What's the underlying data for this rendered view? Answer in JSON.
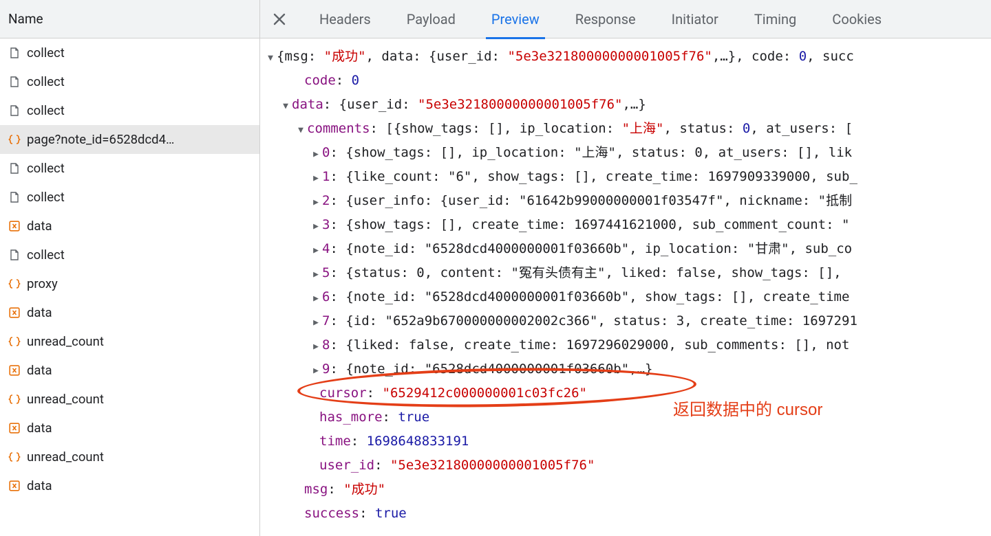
{
  "left": {
    "header": "Name",
    "items": [
      {
        "icon": "doc",
        "name": "collect",
        "selected": false
      },
      {
        "icon": "doc",
        "name": "collect",
        "selected": false
      },
      {
        "icon": "doc",
        "name": "collect",
        "selected": false
      },
      {
        "icon": "json-orange",
        "name": "page?note_id=6528dcd4…",
        "selected": true
      },
      {
        "icon": "doc",
        "name": "collect",
        "selected": false
      },
      {
        "icon": "doc",
        "name": "collect",
        "selected": false
      },
      {
        "icon": "xhr-orange",
        "name": "data",
        "selected": false
      },
      {
        "icon": "doc",
        "name": "collect",
        "selected": false
      },
      {
        "icon": "json-orange",
        "name": "proxy",
        "selected": false
      },
      {
        "icon": "xhr-orange",
        "name": "data",
        "selected": false
      },
      {
        "icon": "json-orange",
        "name": "unread_count",
        "selected": false
      },
      {
        "icon": "xhr-orange",
        "name": "data",
        "selected": false
      },
      {
        "icon": "json-orange",
        "name": "unread_count",
        "selected": false
      },
      {
        "icon": "xhr-orange",
        "name": "data",
        "selected": false
      },
      {
        "icon": "json-orange",
        "name": "unread_count",
        "selected": false
      },
      {
        "icon": "xhr-orange",
        "name": "data",
        "selected": false
      }
    ]
  },
  "tabs": [
    {
      "label": "Headers",
      "active": false
    },
    {
      "label": "Payload",
      "active": false
    },
    {
      "label": "Preview",
      "active": true
    },
    {
      "label": "Response",
      "active": false
    },
    {
      "label": "Initiator",
      "active": false
    },
    {
      "label": "Timing",
      "active": false
    },
    {
      "label": "Cookies",
      "active": false
    }
  ],
  "preview": {
    "root_summary_pre": "{msg: ",
    "root_summary_msg": "\"成功\"",
    "root_summary_mid1": ", data: {user_id: ",
    "root_summary_uid": "\"5e3e32180000000001005f76\"",
    "root_summary_mid2": ",…}, code: ",
    "root_summary_code": "0",
    "root_summary_post": ", succ",
    "code_key": "code",
    "code_val": "0",
    "data_key": "data",
    "data_summary_pre": "{user_id: ",
    "data_summary_uid": "\"5e3e32180000000001005f76\"",
    "data_summary_post": ",…}",
    "comments_key": "comments",
    "comments_summary_pre": "[{show_tags: [], ip_location: ",
    "comments_summary_loc": "\"上海\"",
    "comments_summary_mid": ", status: ",
    "comments_summary_status": "0",
    "comments_summary_post": ", at_users: [",
    "items": [
      "{show_tags: [], ip_location: \"上海\", status: 0, at_users: [], lik",
      "{like_count: \"6\", show_tags: [], create_time: 1697909339000, sub_",
      "{user_info: {user_id: \"61642b99000000001f03547f\", nickname: \"抵制",
      "{show_tags: [], create_time: 1697441621000, sub_comment_count: \"",
      "{note_id: \"6528dcd4000000001f03660b\", ip_location: \"甘肃\", sub_co",
      "{status: 0, content: \"冤有头债有主\", liked: false, show_tags: [], ",
      "{note_id: \"6528dcd4000000001f03660b\", show_tags: [], create_time",
      "{id: \"652a9b670000000002002c366\", status: 3, create_time: 1697291",
      "{liked: false, create_time: 1697296029000, sub_comments: [], not",
      "{note_id: \"6528dcd4000000001f03660b\",…}"
    ],
    "cursor_key": "cursor",
    "cursor_val": "\"6529412c000000001c03fc26\"",
    "has_more_key": "has_more",
    "has_more_val": "true",
    "time_key": "time",
    "time_val": "1698648833191",
    "user_id_key": "user_id",
    "user_id_val": "\"5e3e32180000000001005f76\"",
    "msg_key": "msg",
    "msg_val": "\"成功\"",
    "success_key": "success",
    "success_val": "true"
  },
  "annotation": {
    "text": "返回数据中的 cursor"
  }
}
